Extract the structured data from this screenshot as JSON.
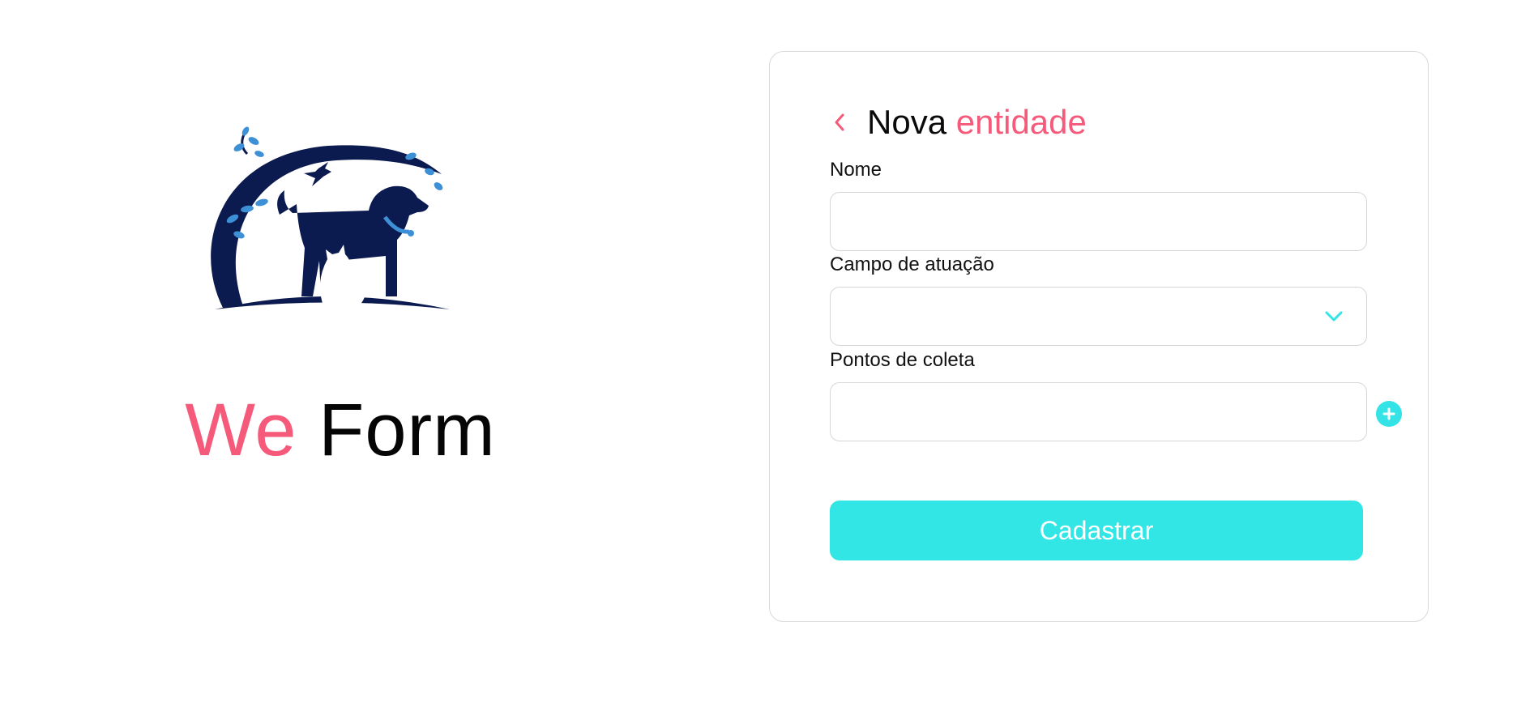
{
  "colors": {
    "accent_pink": "#f55a7b",
    "accent_cyan": "#33e6e6",
    "logo_navy": "#0b1a4f",
    "logo_blue": "#3d8fd6",
    "border": "#d9d9d9"
  },
  "brand": {
    "logo_icon": "pets-logo-dog-cat-bird-tree",
    "title_part1": "We",
    "title_part2": "Form"
  },
  "form": {
    "back_icon": "chevron-left-icon",
    "title_part1": "Nova",
    "title_part2": "entidade",
    "fields": {
      "nome": {
        "label": "Nome",
        "value": "",
        "placeholder": ""
      },
      "campo": {
        "label": "Campo de atuação",
        "value": "",
        "icon": "chevron-down-icon"
      },
      "pontos": {
        "label": "Pontos de coleta",
        "value": "",
        "placeholder": "",
        "add_icon": "plus-circle-icon"
      }
    },
    "submit_label": "Cadastrar"
  }
}
